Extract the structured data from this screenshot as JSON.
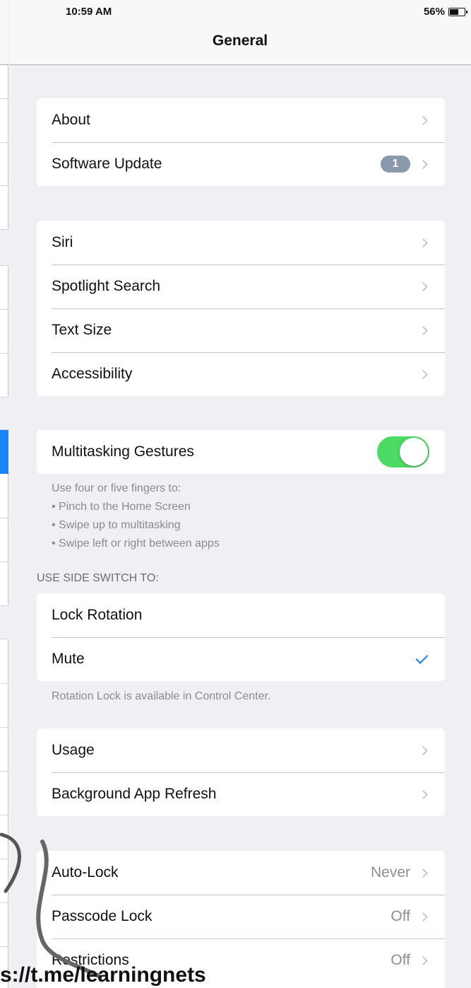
{
  "status_bar": {
    "time": "10:59 AM",
    "battery": "56%"
  },
  "nav": {
    "title": "General"
  },
  "group1": [
    {
      "label": "About"
    },
    {
      "label": "Software Update",
      "badge": "1"
    }
  ],
  "group2": [
    {
      "label": "Siri"
    },
    {
      "label": "Spotlight Search"
    },
    {
      "label": "Text Size"
    },
    {
      "label": "Accessibility"
    }
  ],
  "multitasking": {
    "label": "Multitasking Gestures",
    "enabled": true,
    "footer": [
      "Use four or five fingers to:",
      "• Pinch to the Home Screen",
      "• Swipe up to multitasking",
      "• Swipe left or right between apps"
    ]
  },
  "side_switch": {
    "header": "USE SIDE SWITCH TO:",
    "options": [
      {
        "label": "Lock Rotation",
        "selected": false
      },
      {
        "label": "Mute",
        "selected": true
      }
    ],
    "footer": "Rotation Lock is available in Control Center."
  },
  "group4": [
    {
      "label": "Usage"
    },
    {
      "label": "Background App Refresh"
    }
  ],
  "group5": [
    {
      "label": "Auto-Lock",
      "value": "Never"
    },
    {
      "label": "Passcode Lock",
      "value": "Off"
    },
    {
      "label": "Restrictions",
      "value": "Off"
    }
  ],
  "watermark": "s://t.me/learningnets",
  "colors": {
    "toggle_on": "#4cd964",
    "accent": "#1a7cf5",
    "background": "#efeff4"
  }
}
